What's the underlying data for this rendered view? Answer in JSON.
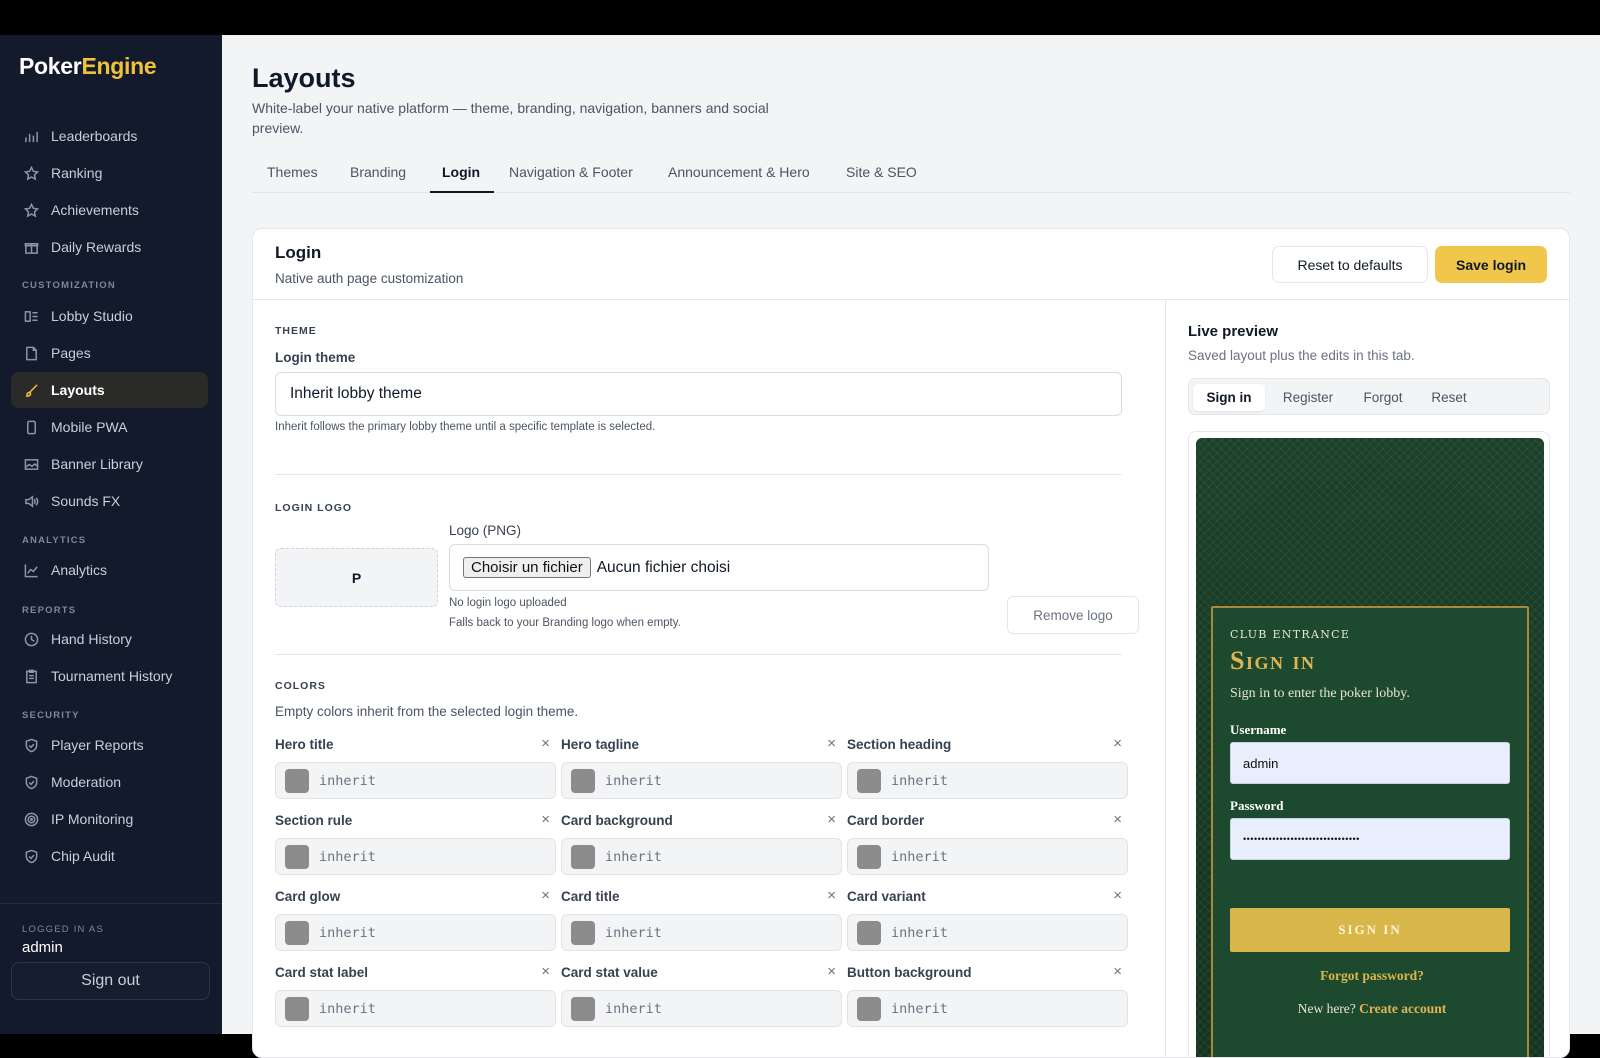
{
  "brand": {
    "part1": "Poker",
    "part2": "Engine"
  },
  "sidebar": {
    "items": [
      {
        "label": "Leaderboards",
        "icon": "bar-chart-icon"
      },
      {
        "label": "Ranking",
        "icon": "star-icon"
      },
      {
        "label": "Achievements",
        "icon": "star-icon"
      },
      {
        "label": "Daily Rewards",
        "icon": "gift-icon"
      },
      {
        "label": "Lobby Studio",
        "icon": "layout-icon"
      },
      {
        "label": "Pages",
        "icon": "page-icon"
      },
      {
        "label": "Layouts",
        "icon": "brush-icon",
        "active": true
      },
      {
        "label": "Mobile PWA",
        "icon": "phone-icon"
      },
      {
        "label": "Banner Library",
        "icon": "image-icon"
      },
      {
        "label": "Sounds FX",
        "icon": "speaker-icon"
      },
      {
        "label": "Analytics",
        "icon": "line-chart-icon"
      },
      {
        "label": "Hand History",
        "icon": "clock-icon"
      },
      {
        "label": "Tournament History",
        "icon": "clipboard-icon"
      },
      {
        "label": "Player Reports",
        "icon": "shield-icon"
      },
      {
        "label": "Moderation",
        "icon": "shield-icon"
      },
      {
        "label": "IP Monitoring",
        "icon": "radar-icon"
      },
      {
        "label": "Chip Audit",
        "icon": "shield-icon"
      }
    ],
    "sections": {
      "customization": "CUSTOMIZATION",
      "analytics": "ANALYTICS",
      "reports": "REPORTS",
      "security": "SECURITY"
    },
    "logged_in_label": "LOGGED IN AS",
    "user": "admin",
    "sign_out": "Sign out"
  },
  "page": {
    "title": "Layouts",
    "description": "White-label your native platform — theme, branding, navigation, banners and social preview."
  },
  "tabs": [
    "Themes",
    "Branding",
    "Login",
    "Navigation & Footer",
    "Announcement & Hero",
    "Site & SEO"
  ],
  "active_tab": "Login",
  "card": {
    "title": "Login",
    "subtitle": "Native auth page customization",
    "reset_label": "Reset to defaults",
    "save_label": "Save login"
  },
  "theme_section": {
    "heading": "THEME",
    "field_label": "Login theme",
    "value": "Inherit lobby theme",
    "hint": "Inherit follows the primary lobby theme until a specific template is selected."
  },
  "logo_section": {
    "heading": "LOGIN LOGO",
    "placeholder_letter": "P",
    "field_label": "Logo (PNG)",
    "file_button": "Choisir un fichier",
    "file_status": "Aucun fichier choisi",
    "hint1": "No login logo uploaded",
    "hint2": "Falls back to your Branding logo when empty.",
    "remove_label": "Remove logo"
  },
  "colors_section": {
    "heading": "COLORS",
    "description": "Empty colors inherit from the selected login theme.",
    "clear_glyph": "×",
    "fields": [
      {
        "label": "Hero title",
        "value": "inherit"
      },
      {
        "label": "Hero tagline",
        "value": "inherit"
      },
      {
        "label": "Section heading",
        "value": "inherit"
      },
      {
        "label": "Section rule",
        "value": "inherit"
      },
      {
        "label": "Card background",
        "value": "inherit"
      },
      {
        "label": "Card border",
        "value": "inherit"
      },
      {
        "label": "Card glow",
        "value": "inherit"
      },
      {
        "label": "Card title",
        "value": "inherit"
      },
      {
        "label": "Card variant",
        "value": "inherit"
      },
      {
        "label": "Card stat label",
        "value": "inherit"
      },
      {
        "label": "Card stat value",
        "value": "inherit"
      },
      {
        "label": "Button background",
        "value": "inherit"
      }
    ]
  },
  "preview": {
    "title": "Live preview",
    "subtitle": "Saved layout plus the edits in this tab.",
    "tabs": [
      "Sign in",
      "Register",
      "Forgot",
      "Reset"
    ],
    "eyebrow": "CLUB ENTRANCE",
    "heading": "Sign in",
    "subheading": "Sign in to enter the poker lobby.",
    "username_label": "Username",
    "username_value": "admin",
    "password_label": "Password",
    "password_value": "••••••••••••••••••••••••••••••••",
    "button": "SIGN IN",
    "forgot": "Forgot password?",
    "new_here": "New here?",
    "create_account": "Create account"
  },
  "colors": {
    "accent": "#f0c23b",
    "sidebar_bg": "#131a2b",
    "preview_green": "#1d4a2f",
    "preview_gold": "#d8b64a"
  }
}
